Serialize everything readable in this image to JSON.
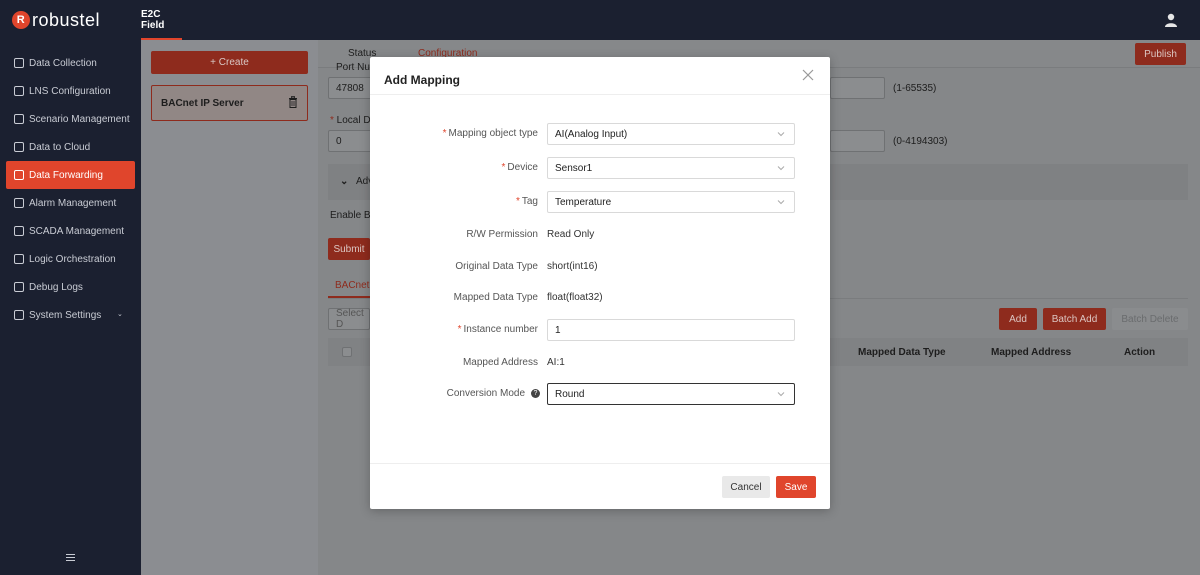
{
  "app": {
    "brand": "robustel",
    "top_tab": "E2C Field"
  },
  "sidebar": {
    "items": [
      {
        "label": "Data Collection",
        "icon": "grid-icon"
      },
      {
        "label": "LNS Configuration",
        "icon": "list-icon"
      },
      {
        "label": "Scenario Management",
        "icon": "layers-icon"
      },
      {
        "label": "Data to Cloud",
        "icon": "cloud-icon"
      },
      {
        "label": "Data Forwarding",
        "icon": "forward-icon"
      },
      {
        "label": "Alarm Management",
        "icon": "alarm-icon"
      },
      {
        "label": "SCADA Management",
        "icon": "scada-icon"
      },
      {
        "label": "Logic Orchestration",
        "icon": "flow-icon"
      },
      {
        "label": "Debug Logs",
        "icon": "log-icon"
      },
      {
        "label": "System Settings",
        "icon": "gear-icon"
      }
    ],
    "active_index": 4
  },
  "left_panel": {
    "create_label": "+ Create",
    "server_name": "BACnet IP Server"
  },
  "main": {
    "tab_status": "Status",
    "tab_configuration": "Configuration",
    "publish_label": "Publish",
    "port_label": "Port Nu",
    "port_value": "47808",
    "port_range": "(1-65535)",
    "local_device_label": "Local De",
    "local_device_value": "0",
    "local_device_range": "(0-4194303)",
    "advanced_label": "Adv",
    "enable_label": "Enable BE",
    "submit_label": "Submit",
    "sub_tab_label": "BACnet",
    "select_placeholder": "Select D",
    "add_label": "Add",
    "batch_add_label": "Batch Add",
    "batch_delete_label": "Batch Delete",
    "table_headers": [
      "Mapped Data Type",
      "Mapped Address",
      "Action"
    ]
  },
  "modal": {
    "title": "Add Mapping",
    "fields": {
      "mapping_object_type": {
        "label": "Mapping object type",
        "value": "AI(Analog Input)"
      },
      "device": {
        "label": "Device",
        "value": "Sensor1"
      },
      "tag": {
        "label": "Tag",
        "value": "Temperature"
      },
      "rw_permission": {
        "label": "R/W Permission",
        "value": "Read Only"
      },
      "original_data_type": {
        "label": "Original Data Type",
        "value": "short(int16)"
      },
      "mapped_data_type": {
        "label": "Mapped Data Type",
        "value": "float(float32)"
      },
      "instance_number": {
        "label": "Instance number",
        "value": "1"
      },
      "mapped_address": {
        "label": "Mapped Address",
        "value": "AI:1"
      },
      "conversion_mode": {
        "label": "Conversion Mode",
        "value": "Round"
      }
    },
    "cancel_label": "Cancel",
    "save_label": "Save"
  },
  "colors": {
    "accent": "#e0452c",
    "sidebar_bg": "#1b2030"
  }
}
